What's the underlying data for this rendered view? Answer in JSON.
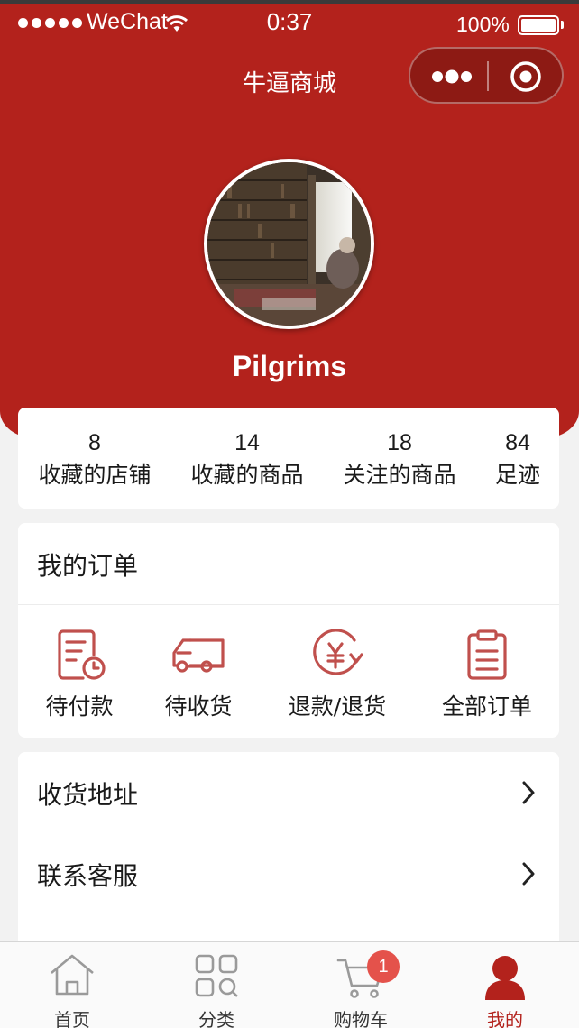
{
  "status_bar": {
    "carrier": "WeChat",
    "time": "0:37",
    "battery": "100%",
    "battery_level": 1.0
  },
  "nav": {
    "title": "牛逼商城"
  },
  "profile": {
    "username": "Pilgrims"
  },
  "stats": [
    {
      "count": "8",
      "label": "收藏的店铺"
    },
    {
      "count": "14",
      "label": "收藏的商品"
    },
    {
      "count": "18",
      "label": "关注的商品"
    },
    {
      "count": "84",
      "label": "足迹"
    }
  ],
  "orders": {
    "title": "我的订单",
    "items": [
      {
        "label": "待付款",
        "icon": "pending-payment-icon"
      },
      {
        "label": "待收货",
        "icon": "delivery-truck-icon"
      },
      {
        "label": "退款/退货",
        "icon": "refund-yen-icon"
      },
      {
        "label": "全部订单",
        "icon": "clipboard-icon"
      }
    ]
  },
  "menu": [
    {
      "label": "收货地址"
    },
    {
      "label": "联系客服"
    }
  ],
  "tabbar": {
    "tabs": [
      {
        "label": "首页",
        "icon": "home-icon"
      },
      {
        "label": "分类",
        "icon": "category-icon"
      },
      {
        "label": "购物车",
        "icon": "cart-icon",
        "badge": "1"
      },
      {
        "label": "我的",
        "icon": "user-icon",
        "active": true
      }
    ]
  },
  "colors": {
    "brand": "#b3221c",
    "icon_accent": "#c0504d",
    "badge": "#e4524b",
    "background": "#f2f2f2"
  }
}
